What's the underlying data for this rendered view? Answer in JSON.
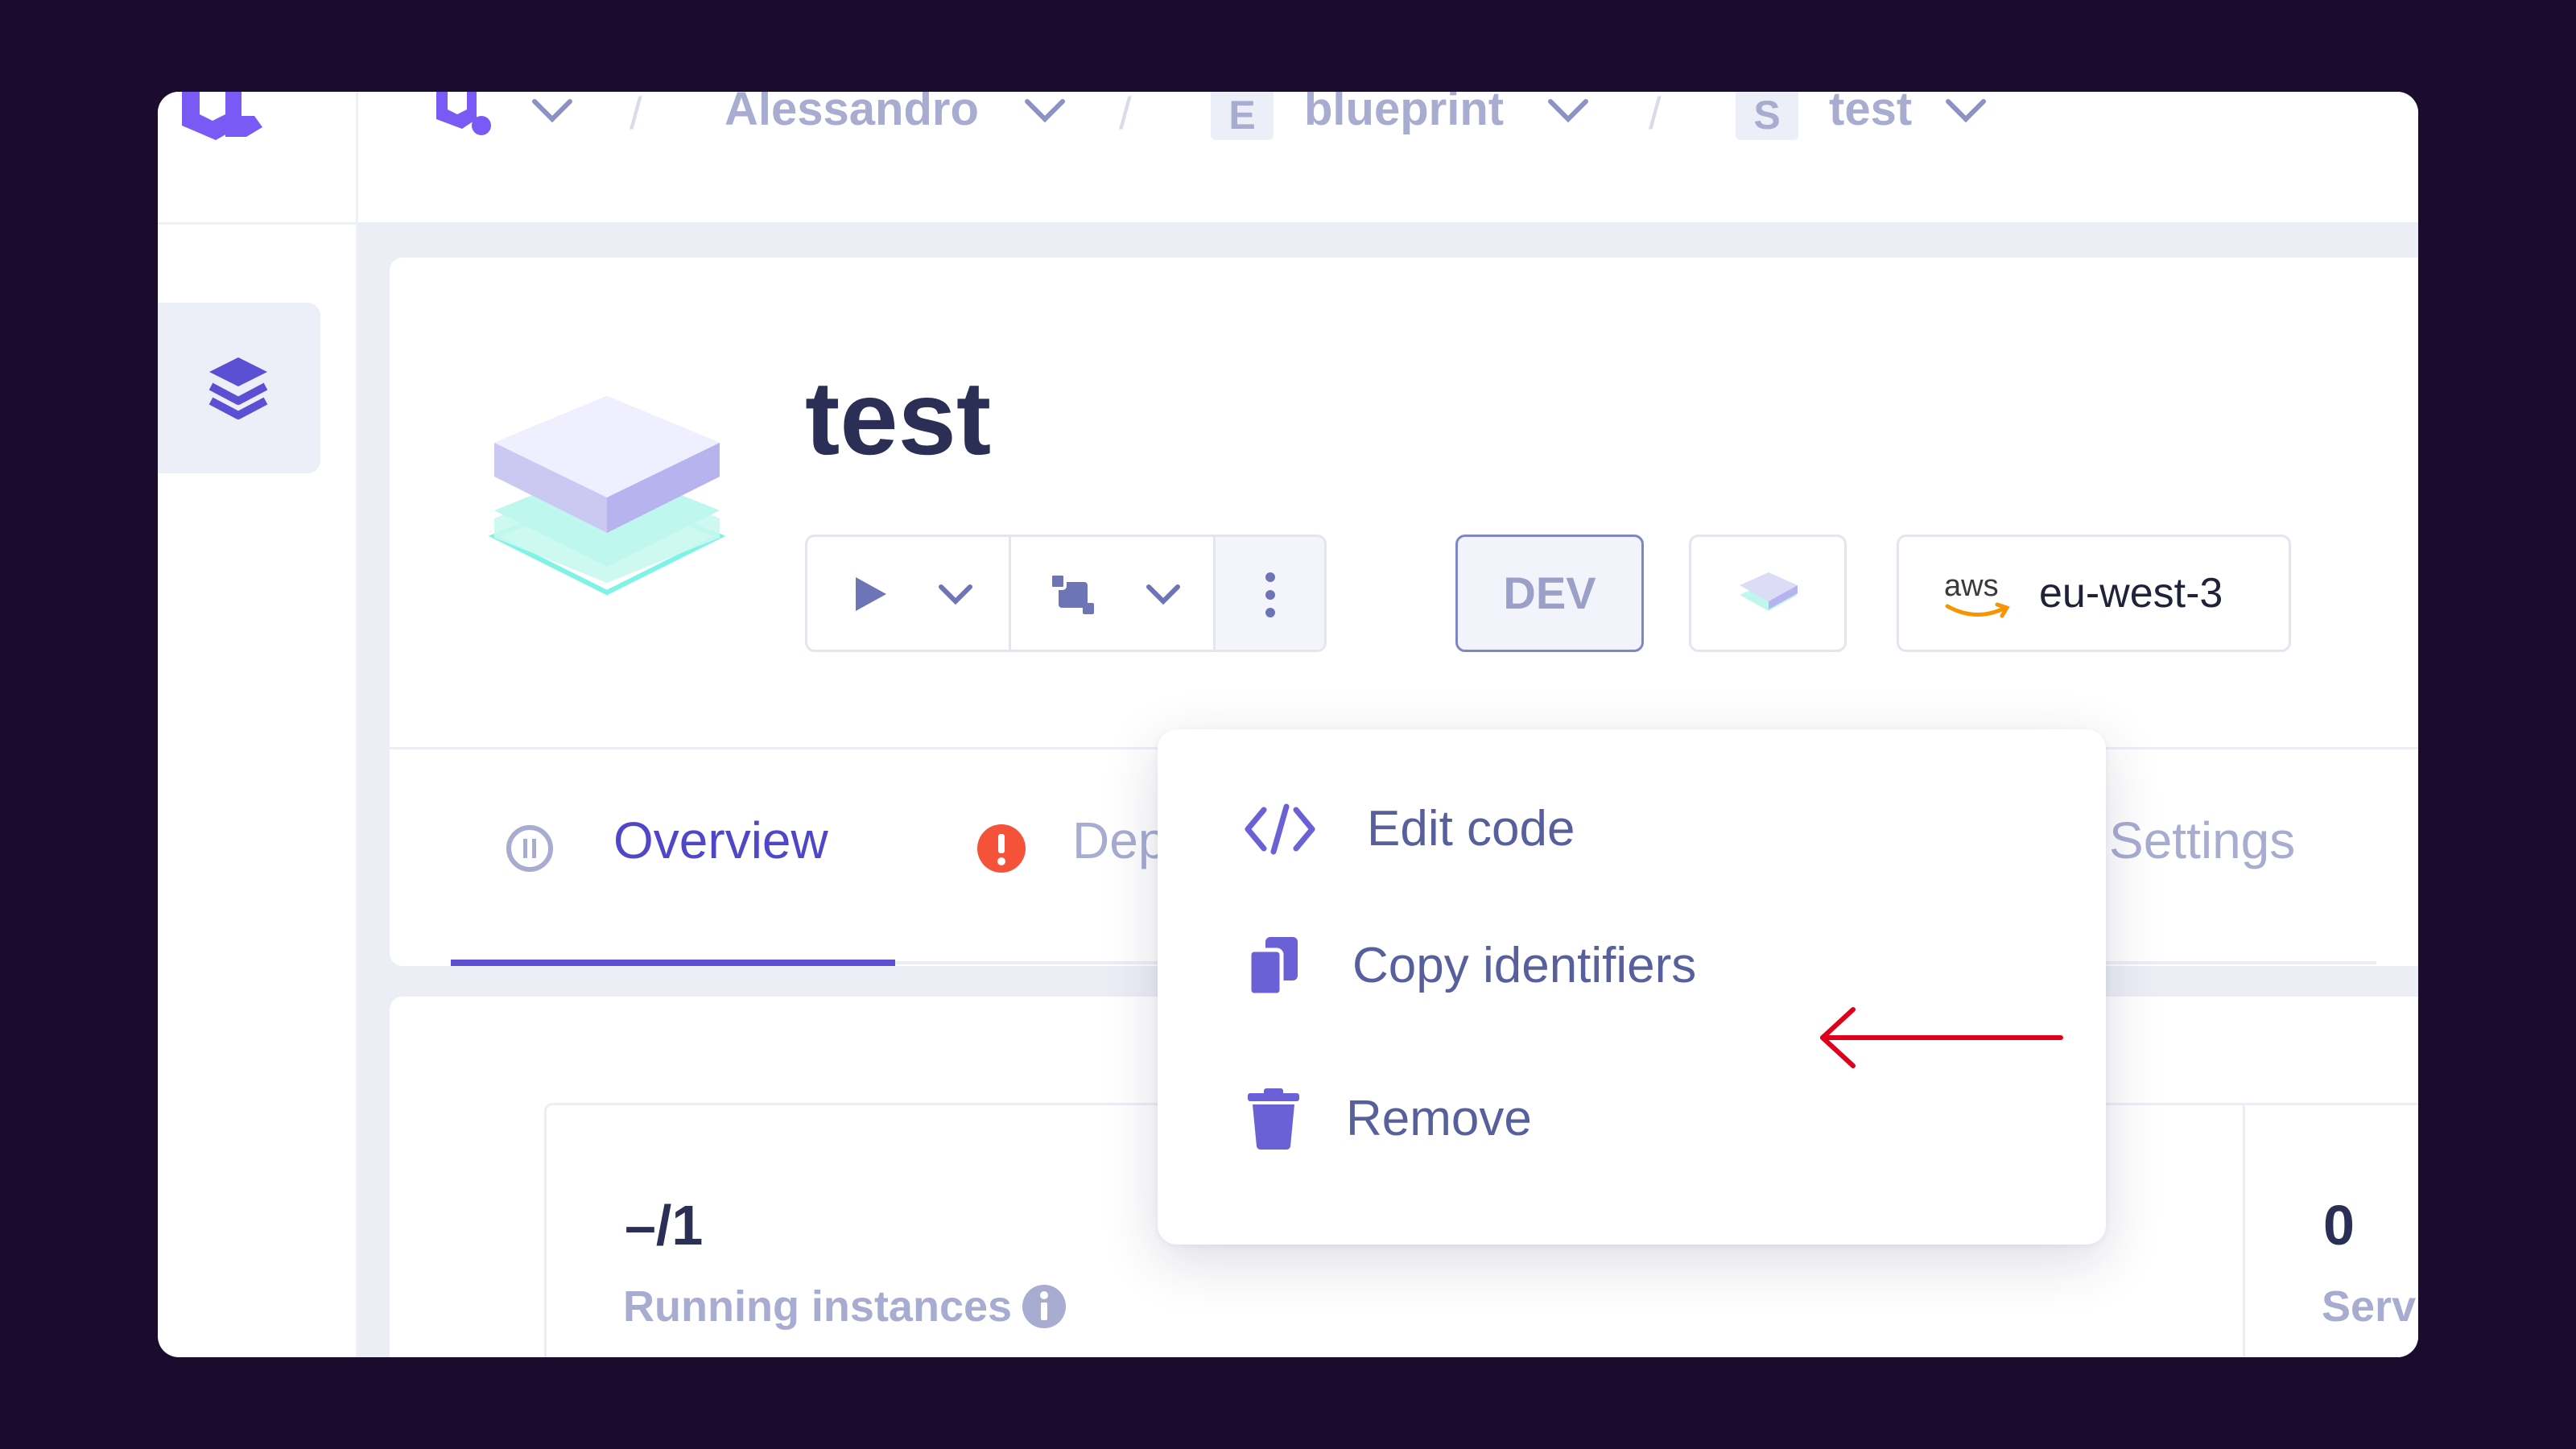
{
  "breadcrumb": {
    "org_label": "Alessandro",
    "project_badge": "E",
    "project_label": "blueprint",
    "env_badge": "S",
    "env_label": "test"
  },
  "service": {
    "title": "test",
    "env_type": "DEV",
    "cloud_provider": "aws",
    "region": "eu-west-3"
  },
  "tabs": [
    {
      "label": "Overview",
      "active": true
    },
    {
      "label": "Dep",
      "status": "error"
    },
    {
      "label": "Settings"
    }
  ],
  "menu": {
    "items": [
      {
        "label": "Edit code",
        "icon": "code-icon"
      },
      {
        "label": "Copy identifiers",
        "icon": "copy-icon"
      },
      {
        "label": "Remove",
        "icon": "trash-icon"
      }
    ]
  },
  "stats": {
    "running_instances_value": "–/1",
    "running_instances_label": "Running instances",
    "second_value": "0",
    "second_label": "Serv"
  },
  "colors": {
    "backdrop": "#1b0c2e",
    "accent": "#5b4fd3",
    "menu_text": "#575f9c",
    "annotation_arrow": "#e0001b",
    "error_badge": "#f4533a"
  }
}
